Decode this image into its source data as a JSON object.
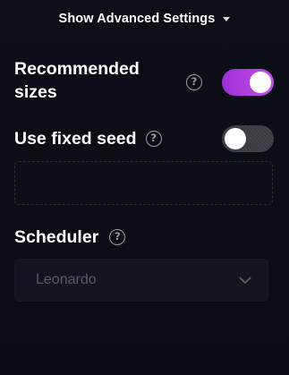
{
  "advanced_settings": {
    "toggle_label": "Show Advanced Settings"
  },
  "recommended_sizes": {
    "label": "Recommended sizes",
    "help_glyph": "?",
    "enabled": true
  },
  "fixed_seed": {
    "label": "Use fixed seed",
    "help_glyph": "?",
    "enabled": false,
    "value": "",
    "placeholder": ""
  },
  "scheduler": {
    "label": "Scheduler",
    "help_glyph": "?",
    "selected": "Leonardo"
  },
  "colors": {
    "toggle_on_start": "#9b2ed6",
    "toggle_on_end": "#c652e8",
    "toggle_off": "#3a3b42",
    "background": "#0d0f18"
  },
  "icons": {
    "caret": "caret-down-icon",
    "help": "question-circle-icon",
    "chevron": "chevron-down-icon"
  }
}
